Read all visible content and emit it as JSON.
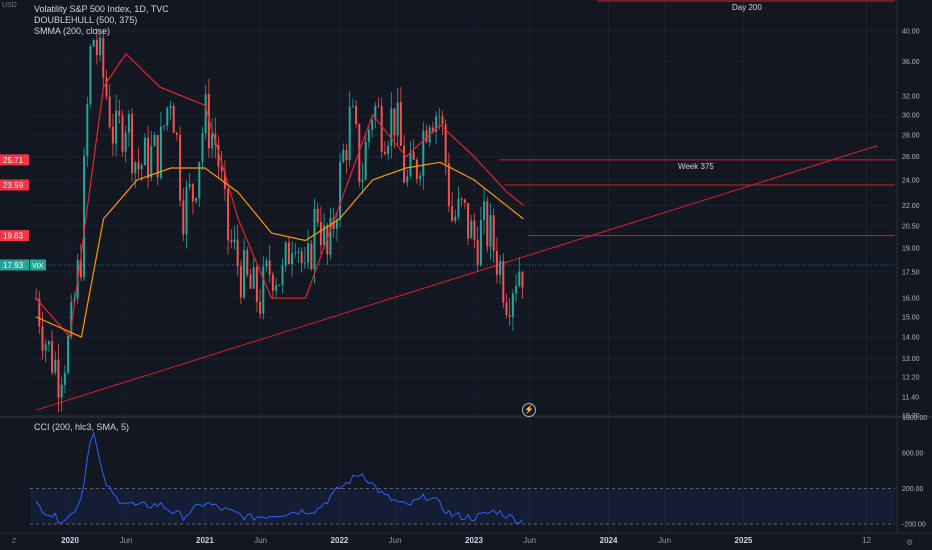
{
  "header": {
    "currency": "USD",
    "symbol_line": "Volatility S&P 500 Index, 1D, TVC",
    "indicator_1": "DOUBLEHULL (500, 375)",
    "indicator_2": "SMMA (200, close)",
    "cci_label": "CCI (200, hlc3, SMA, 5)"
  },
  "annotations": {
    "day200": "Day 200",
    "week375": "Week 375"
  },
  "footer": {
    "timezone_icon": "Z",
    "settings_icon": "gear-icon"
  },
  "price_badges": [
    {
      "value": "25.71",
      "color": "#f23645"
    },
    {
      "value": "23.59",
      "color": "#f23645"
    },
    {
      "value": "19.83",
      "color": "#f23645"
    },
    {
      "value": "17.93",
      "color": "#26a69a"
    }
  ],
  "vix_tag": "VIX",
  "colors": {
    "background": "#131722",
    "up": "#26a69a",
    "down": "#ef5350",
    "hull_red": "#e0262e",
    "smma_orange": "#ff9800",
    "trend_line": "#d61e2b",
    "cci_line": "#2962ff"
  },
  "chart_data": [
    {
      "type": "candlestick",
      "title": "Volatility S&P 500 Index, 1D, TVC",
      "ylabel": "USD",
      "ylim": [
        10.7,
        42.5
      ],
      "y_scale": "log",
      "y_ticks": [
        "40.00",
        "36.00",
        "32.00",
        "30.00",
        "28.00",
        "26.00",
        "24.00",
        "22.00",
        "20.50",
        "19.00",
        "17.50",
        "16.00",
        "15.00",
        "14.00",
        "13.00",
        "12.20",
        "11.40",
        "10.70"
      ],
      "x_ticks": [
        "2020",
        "Jun",
        "2021",
        "Jun",
        "2022",
        "Jun",
        "2023",
        "Jun",
        "2024",
        "Jun",
        "2025",
        "12"
      ],
      "x_tick_dates": [
        "2020-01-01",
        "2020-06-01",
        "2021-01-01",
        "2021-06-01",
        "2022-01-01",
        "2022-06-01",
        "2023-01-01",
        "2023-06-01",
        "2024-01-01",
        "2024-06-01",
        "2025-01-01",
        "2025-12-01"
      ],
      "close_series": {
        "name": "VIX",
        "dates": [
          "2019-10-01",
          "2019-11-01",
          "2019-12-01",
          "2020-01-01",
          "2020-02-01",
          "2020-03-01",
          "2020-04-01",
          "2020-05-01",
          "2020-06-01",
          "2020-07-01",
          "2020-08-01",
          "2020-09-01",
          "2020-10-01",
          "2020-11-01",
          "2020-12-01",
          "2021-01-01",
          "2021-02-01",
          "2021-03-01",
          "2021-04-01",
          "2021-05-01",
          "2021-06-01",
          "2021-07-01",
          "2021-08-01",
          "2021-09-01",
          "2021-10-01",
          "2021-11-01",
          "2021-12-01",
          "2022-01-01",
          "2022-02-01",
          "2022-03-01",
          "2022-04-01",
          "2022-05-01",
          "2022-06-01",
          "2022-07-01",
          "2022-08-01",
          "2022-09-01",
          "2022-10-01",
          "2022-11-01",
          "2022-12-01",
          "2023-01-01",
          "2023-02-01",
          "2023-03-01",
          "2023-04-01",
          "2023-05-01"
        ],
        "values": [
          16.0,
          13.5,
          12.5,
          13.8,
          19.0,
          40.0,
          34.0,
          27.5,
          30.0,
          25.0,
          26.0,
          26.5,
          33.0,
          22.0,
          23.0,
          30.0,
          27.0,
          20.0,
          18.0,
          16.5,
          16.0,
          18.0,
          17.0,
          21.0,
          16.5,
          22.0,
          18.0,
          24.0,
          30.0,
          24.0,
          31.0,
          29.0,
          30.0,
          23.5,
          25.5,
          31.0,
          30.0,
          21.0,
          21.5,
          19.5,
          20.5,
          18.8,
          16.3,
          17.9
        ]
      },
      "overlays": [
        {
          "name": "DOUBLEHULL (500, 375)",
          "dates": [
            "2019-10-01",
            "2020-01-01",
            "2020-04-01",
            "2020-06-01",
            "2020-09-01",
            "2021-01-01",
            "2021-04-01",
            "2021-07-01",
            "2021-10-01",
            "2022-01-01",
            "2022-04-01",
            "2022-07-01",
            "2022-10-01",
            "2023-01-01",
            "2023-04-01",
            "2023-05-15"
          ],
          "values": [
            16,
            14,
            33,
            37,
            33,
            31,
            21,
            16,
            16,
            22,
            30,
            26,
            29,
            26,
            23,
            22
          ]
        },
        {
          "name": "SMMA (200, close)",
          "dates": [
            "2019-10-01",
            "2020-02-01",
            "2020-04-01",
            "2020-07-01",
            "2020-10-01",
            "2021-01-01",
            "2021-04-01",
            "2021-07-01",
            "2021-10-01",
            "2022-01-01",
            "2022-04-01",
            "2022-07-01",
            "2022-10-01",
            "2023-01-01",
            "2023-05-15"
          ],
          "values": [
            15,
            14,
            21,
            24,
            25,
            25,
            23,
            20,
            19.5,
            21,
            24,
            25,
            25.5,
            24,
            21
          ]
        }
      ],
      "horizontal_levels": [
        {
          "label": "Day 200",
          "value": 43.2
        },
        {
          "label": "Week 375",
          "value": 25.71
        },
        {
          "label": "",
          "value": 23.59
        },
        {
          "label": "",
          "value": 19.83
        }
      ],
      "trend_line": {
        "start_date": "2019-10-01",
        "start_value": 10.9,
        "end_date": "2025-12-31",
        "end_value": 27.0
      },
      "last_price": 17.93
    },
    {
      "type": "line",
      "title": "CCI (200, hlc3, SMA, 5)",
      "ylim": [
        -300,
        1000
      ],
      "y_ticks": [
        "1000.00",
        "600.00",
        "200.00",
        "-200.00"
      ],
      "band": [
        -200,
        200
      ],
      "series": [
        {
          "name": "CCI",
          "dates": [
            "2019-10-01",
            "2019-12-01",
            "2020-01-01",
            "2020-02-01",
            "2020-03-01",
            "2020-04-01",
            "2020-05-01",
            "2020-07-01",
            "2020-09-01",
            "2020-11-01",
            "2021-01-01",
            "2021-03-01",
            "2021-05-01",
            "2021-07-01",
            "2021-09-01",
            "2021-11-01",
            "2022-01-01",
            "2022-03-01",
            "2022-05-01",
            "2022-07-01",
            "2022-09-01",
            "2022-11-01",
            "2023-01-01",
            "2023-03-01",
            "2023-05-01"
          ],
          "values": [
            20,
            -150,
            -120,
            100,
            900,
            300,
            100,
            0,
            20,
            -120,
            40,
            -50,
            -130,
            -100,
            -60,
            -40,
            200,
            380,
            120,
            0,
            120,
            -100,
            -130,
            -50,
            -160
          ]
        }
      ]
    }
  ]
}
